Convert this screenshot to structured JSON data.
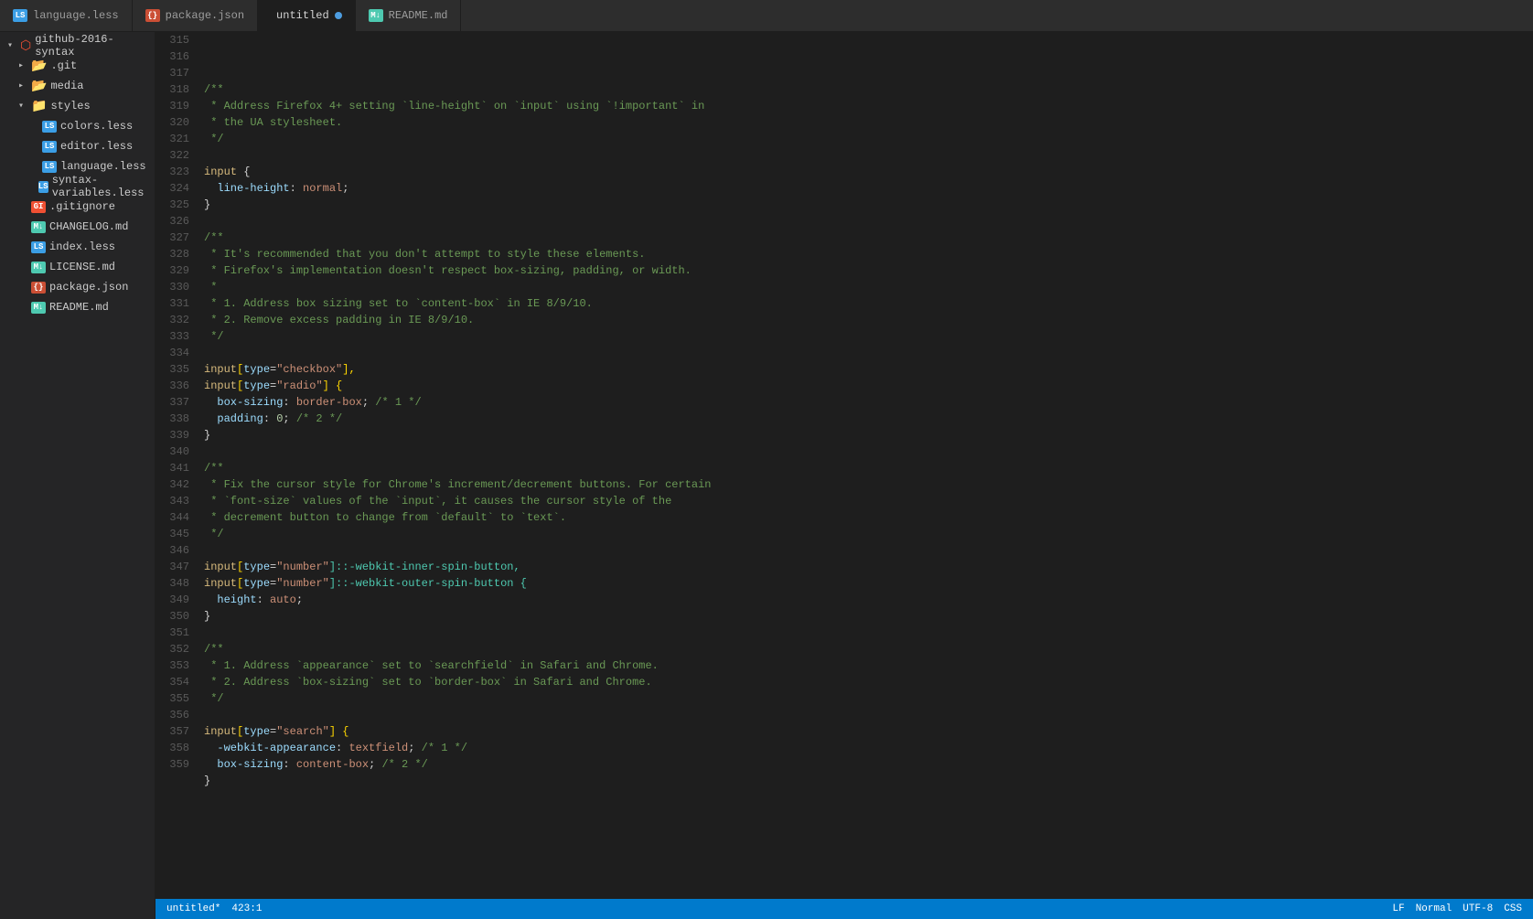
{
  "tabs": [
    {
      "id": "language-less",
      "label": "language.less",
      "icon_color": "#3b9ee5",
      "icon_type": "less",
      "active": false
    },
    {
      "id": "package-json",
      "label": "package.json",
      "icon_color": "#cb4f35",
      "icon_type": "json",
      "active": false
    },
    {
      "id": "untitled",
      "label": "untitled",
      "icon_color": "#4d9de0",
      "icon_type": "none",
      "active": true,
      "modified": true
    },
    {
      "id": "readme-md",
      "label": "README.md",
      "icon_color": "#4ec9b0",
      "icon_type": "md",
      "active": false
    }
  ],
  "sidebar": {
    "root_label": "github-2016-syntax",
    "items": [
      {
        "id": "git",
        "label": ".git",
        "type": "folder",
        "indent": 1,
        "collapsed": true
      },
      {
        "id": "media",
        "label": "media",
        "type": "folder",
        "indent": 1,
        "collapsed": true
      },
      {
        "id": "styles",
        "label": "styles",
        "type": "folder",
        "indent": 1,
        "collapsed": false
      },
      {
        "id": "colors-less",
        "label": "colors.less",
        "type": "less",
        "indent": 2
      },
      {
        "id": "editor-less",
        "label": "editor.less",
        "type": "less",
        "indent": 2
      },
      {
        "id": "language-less",
        "label": "language.less",
        "type": "less",
        "indent": 2
      },
      {
        "id": "syntax-variables-less",
        "label": "syntax-variables.less",
        "type": "less",
        "indent": 2
      },
      {
        "id": "gitignore",
        "label": ".gitignore",
        "type": "gitignore",
        "indent": 1
      },
      {
        "id": "changelog-md",
        "label": "CHANGELOG.md",
        "type": "md",
        "indent": 1
      },
      {
        "id": "index-less",
        "label": "index.less",
        "type": "less",
        "indent": 1
      },
      {
        "id": "license-md",
        "label": "LICENSE.md",
        "type": "md",
        "indent": 1
      },
      {
        "id": "package-json",
        "label": "package.json",
        "type": "json",
        "indent": 1
      },
      {
        "id": "readme-md",
        "label": "README.md",
        "type": "md",
        "indent": 1
      }
    ]
  },
  "code_lines": [
    {
      "num": 315,
      "content": ""
    },
    {
      "num": 316,
      "tokens": [
        {
          "t": "/**",
          "c": "c-comment"
        }
      ]
    },
    {
      "num": 317,
      "tokens": [
        {
          "t": " * Address Firefox 4+ setting `line-height` on `input` using `!important` in",
          "c": "c-comment"
        }
      ]
    },
    {
      "num": 318,
      "tokens": [
        {
          "t": " * the UA stylesheet.",
          "c": "c-comment"
        }
      ]
    },
    {
      "num": 319,
      "tokens": [
        {
          "t": " */",
          "c": "c-comment"
        }
      ]
    },
    {
      "num": 320,
      "content": ""
    },
    {
      "num": 321,
      "tokens": [
        {
          "t": "input",
          "c": "c-selector"
        },
        {
          "t": " {",
          "c": "c-punct"
        }
      ]
    },
    {
      "num": 322,
      "tokens": [
        {
          "t": "  line-height",
          "c": "c-property"
        },
        {
          "t": ": ",
          "c": "c-punct"
        },
        {
          "t": "normal",
          "c": "c-value"
        },
        {
          "t": ";",
          "c": "c-punct"
        }
      ]
    },
    {
      "num": 323,
      "tokens": [
        {
          "t": "}",
          "c": "c-punct"
        }
      ]
    },
    {
      "num": 324,
      "content": ""
    },
    {
      "num": 325,
      "tokens": [
        {
          "t": "/**",
          "c": "c-comment"
        }
      ]
    },
    {
      "num": 326,
      "tokens": [
        {
          "t": " * It's recommended that you don't attempt to style these elements.",
          "c": "c-comment"
        }
      ]
    },
    {
      "num": 327,
      "tokens": [
        {
          "t": " * Firefox's implementation doesn't respect box-sizing, padding, or width.",
          "c": "c-comment"
        }
      ]
    },
    {
      "num": 328,
      "tokens": [
        {
          "t": " *",
          "c": "c-comment"
        }
      ]
    },
    {
      "num": 329,
      "tokens": [
        {
          "t": " * 1. Address box sizing set to `content-box` in IE 8/9/10.",
          "c": "c-comment"
        }
      ]
    },
    {
      "num": 330,
      "tokens": [
        {
          "t": " * 2. Remove excess padding in IE 8/9/10.",
          "c": "c-comment"
        }
      ]
    },
    {
      "num": 331,
      "tokens": [
        {
          "t": " */",
          "c": "c-comment"
        }
      ]
    },
    {
      "num": 332,
      "content": ""
    },
    {
      "num": 333,
      "tokens": [
        {
          "t": "input",
          "c": "c-selector"
        },
        {
          "t": "[",
          "c": "c-attr-bracket"
        },
        {
          "t": "type",
          "c": "c-attr-name"
        },
        {
          "t": "=",
          "c": "c-punct"
        },
        {
          "t": "\"checkbox\"",
          "c": "c-attr-value"
        },
        {
          "t": "],",
          "c": "c-attr-bracket"
        }
      ]
    },
    {
      "num": 334,
      "tokens": [
        {
          "t": "input",
          "c": "c-selector"
        },
        {
          "t": "[",
          "c": "c-attr-bracket"
        },
        {
          "t": "type",
          "c": "c-attr-name"
        },
        {
          "t": "=",
          "c": "c-punct"
        },
        {
          "t": "\"radio\"",
          "c": "c-attr-value"
        },
        {
          "t": "] {",
          "c": "c-attr-bracket"
        }
      ]
    },
    {
      "num": 335,
      "tokens": [
        {
          "t": "  box-sizing",
          "c": "c-property"
        },
        {
          "t": ": ",
          "c": "c-punct"
        },
        {
          "t": "border-box",
          "c": "c-value"
        },
        {
          "t": "; ",
          "c": "c-punct"
        },
        {
          "t": "/* 1 */",
          "c": "c-comment"
        }
      ]
    },
    {
      "num": 336,
      "tokens": [
        {
          "t": "  padding",
          "c": "c-property"
        },
        {
          "t": ": ",
          "c": "c-punct"
        },
        {
          "t": "0",
          "c": "c-number"
        },
        {
          "t": "; ",
          "c": "c-punct"
        },
        {
          "t": "/* 2 */",
          "c": "c-comment"
        }
      ]
    },
    {
      "num": 337,
      "tokens": [
        {
          "t": "}",
          "c": "c-punct"
        }
      ]
    },
    {
      "num": 338,
      "content": ""
    },
    {
      "num": 339,
      "tokens": [
        {
          "t": "/**",
          "c": "c-comment"
        }
      ]
    },
    {
      "num": 340,
      "tokens": [
        {
          "t": " * Fix the cursor style for Chrome's increment/decrement buttons. For certain",
          "c": "c-comment"
        }
      ]
    },
    {
      "num": 341,
      "tokens": [
        {
          "t": " * `font-size` values of the `input`, it causes the cursor style of the",
          "c": "c-comment"
        }
      ]
    },
    {
      "num": 342,
      "tokens": [
        {
          "t": " * decrement button to change from `default` to `text`.",
          "c": "c-comment"
        }
      ]
    },
    {
      "num": 343,
      "tokens": [
        {
          "t": " */",
          "c": "c-comment"
        }
      ]
    },
    {
      "num": 344,
      "content": ""
    },
    {
      "num": 345,
      "tokens": [
        {
          "t": "input",
          "c": "c-selector"
        },
        {
          "t": "[",
          "c": "c-attr-bracket"
        },
        {
          "t": "type",
          "c": "c-attr-name"
        },
        {
          "t": "=",
          "c": "c-punct"
        },
        {
          "t": "\"number\"",
          "c": "c-attr-value"
        },
        {
          "t": "]::-webkit-inner-spin-button,",
          "c": "c-pseudo"
        }
      ]
    },
    {
      "num": 346,
      "tokens": [
        {
          "t": "input",
          "c": "c-selector"
        },
        {
          "t": "[",
          "c": "c-attr-bracket"
        },
        {
          "t": "type",
          "c": "c-attr-name"
        },
        {
          "t": "=",
          "c": "c-punct"
        },
        {
          "t": "\"number\"",
          "c": "c-attr-value"
        },
        {
          "t": "]::-webkit-outer-spin-button {",
          "c": "c-pseudo"
        }
      ]
    },
    {
      "num": 347,
      "tokens": [
        {
          "t": "  height",
          "c": "c-property"
        },
        {
          "t": ": ",
          "c": "c-punct"
        },
        {
          "t": "auto",
          "c": "c-value"
        },
        {
          "t": ";",
          "c": "c-punct"
        }
      ]
    },
    {
      "num": 348,
      "tokens": [
        {
          "t": "}",
          "c": "c-punct"
        }
      ]
    },
    {
      "num": 349,
      "content": ""
    },
    {
      "num": 350,
      "tokens": [
        {
          "t": "/**",
          "c": "c-comment"
        }
      ]
    },
    {
      "num": 351,
      "tokens": [
        {
          "t": " * 1. Address `appearance` set to `searchfield` in Safari and Chrome.",
          "c": "c-comment"
        }
      ]
    },
    {
      "num": 352,
      "tokens": [
        {
          "t": " * 2. Address `box-sizing` set to `border-box` in Safari and Chrome.",
          "c": "c-comment"
        }
      ]
    },
    {
      "num": 353,
      "tokens": [
        {
          "t": " */",
          "c": "c-comment"
        }
      ]
    },
    {
      "num": 354,
      "content": ""
    },
    {
      "num": 355,
      "tokens": [
        {
          "t": "input",
          "c": "c-selector"
        },
        {
          "t": "[",
          "c": "c-attr-bracket"
        },
        {
          "t": "type",
          "c": "c-attr-name"
        },
        {
          "t": "=",
          "c": "c-punct"
        },
        {
          "t": "\"search\"",
          "c": "c-attr-value"
        },
        {
          "t": "] {",
          "c": "c-attr-bracket"
        }
      ]
    },
    {
      "num": 356,
      "tokens": [
        {
          "t": "  -webkit-appearance",
          "c": "c-property"
        },
        {
          "t": ": ",
          "c": "c-punct"
        },
        {
          "t": "textfield",
          "c": "c-value"
        },
        {
          "t": "; ",
          "c": "c-punct"
        },
        {
          "t": "/* 1 */",
          "c": "c-comment"
        }
      ]
    },
    {
      "num": 357,
      "tokens": [
        {
          "t": "  box-sizing",
          "c": "c-property"
        },
        {
          "t": ": ",
          "c": "c-punct"
        },
        {
          "t": "content-box",
          "c": "c-value"
        },
        {
          "t": "; ",
          "c": "c-punct"
        },
        {
          "t": "/* 2 */",
          "c": "c-comment"
        }
      ]
    },
    {
      "num": 358,
      "tokens": [
        {
          "t": "}",
          "c": "c-punct"
        }
      ]
    },
    {
      "num": 359,
      "content": ""
    }
  ],
  "status_bar": {
    "left": {
      "filename": "untitled*",
      "position": "423:1"
    },
    "right": {
      "line_ending": "LF",
      "indent": "Normal",
      "encoding": "UTF-8",
      "language": "CSS"
    }
  }
}
